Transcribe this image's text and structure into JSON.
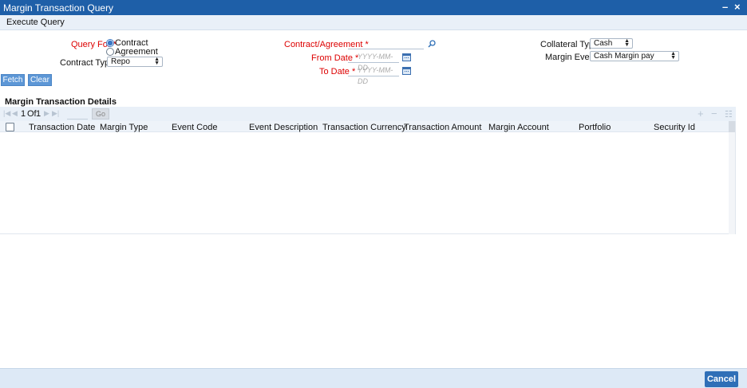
{
  "window": {
    "title": "Margin Transaction Query",
    "minimize": "–",
    "close": "×"
  },
  "menu": {
    "execute_query": "Execute Query"
  },
  "form": {
    "query_for": {
      "label": "Query For",
      "required": "*",
      "options": [
        "Contract",
        "Agreement"
      ],
      "selected": "Contract"
    },
    "contract_type": {
      "label": "Contract Type",
      "value": "Repo"
    },
    "contract_agreement": {
      "label": "Contract/Agreement",
      "required": "*",
      "value": ""
    },
    "from_date": {
      "label": "From Date",
      "required": "*",
      "placeholder": "YYYY-MM-DD"
    },
    "to_date": {
      "label": "To Date",
      "required": "*",
      "placeholder": "YYYY-MM-DD"
    },
    "collateral_type": {
      "label": "Collateral Type",
      "value": "Cash"
    },
    "margin_event": {
      "label": "Margin Event",
      "value": "Cash Margin pay"
    }
  },
  "buttons": {
    "fetch": "Fetch",
    "clear": "Clear",
    "go": "Go",
    "cancel": "Cancel"
  },
  "details": {
    "title": "Margin Transaction Details",
    "pager": {
      "current": "1",
      "of_label": "Of",
      "total": "1"
    },
    "columns": [
      "Transaction Date",
      "Margin Type",
      "Event Code",
      "Event Description",
      "Transaction Currency",
      "Transaction Amount",
      "Margin Account",
      "Portfolio",
      "Security Id"
    ],
    "rows": []
  },
  "icons": {
    "search": "search-icon",
    "calendar": "calendar-icon",
    "add": "+",
    "remove": "−",
    "single_view": "☷"
  }
}
